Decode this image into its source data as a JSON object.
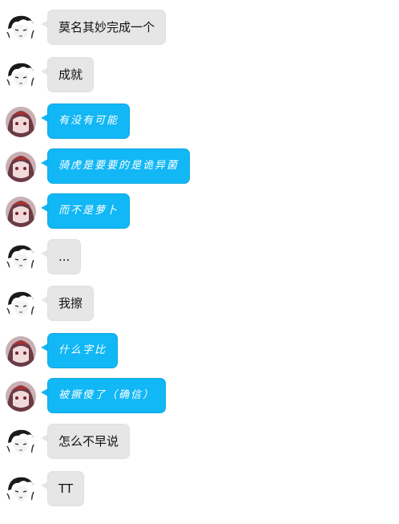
{
  "messages": [
    {
      "sender": "them",
      "text": "莫名其妙完成一个"
    },
    {
      "sender": "them",
      "text": "成就"
    },
    {
      "sender": "me",
      "text": "有没有可能"
    },
    {
      "sender": "me",
      "text": "骑虎是要要的是诡异菌"
    },
    {
      "sender": "me",
      "text": "而不是萝卜"
    },
    {
      "sender": "them",
      "text": "..."
    },
    {
      "sender": "them",
      "text": "我擦"
    },
    {
      "sender": "me",
      "text": "什么字比"
    },
    {
      "sender": "me",
      "text": "被撅傻了（确信）"
    },
    {
      "sender": "them",
      "text": "怎么不早说"
    },
    {
      "sender": "them",
      "text": "TT"
    }
  ],
  "colors": {
    "me_bubble": "#12b7f5",
    "them_bubble": "#e6e6e6"
  }
}
